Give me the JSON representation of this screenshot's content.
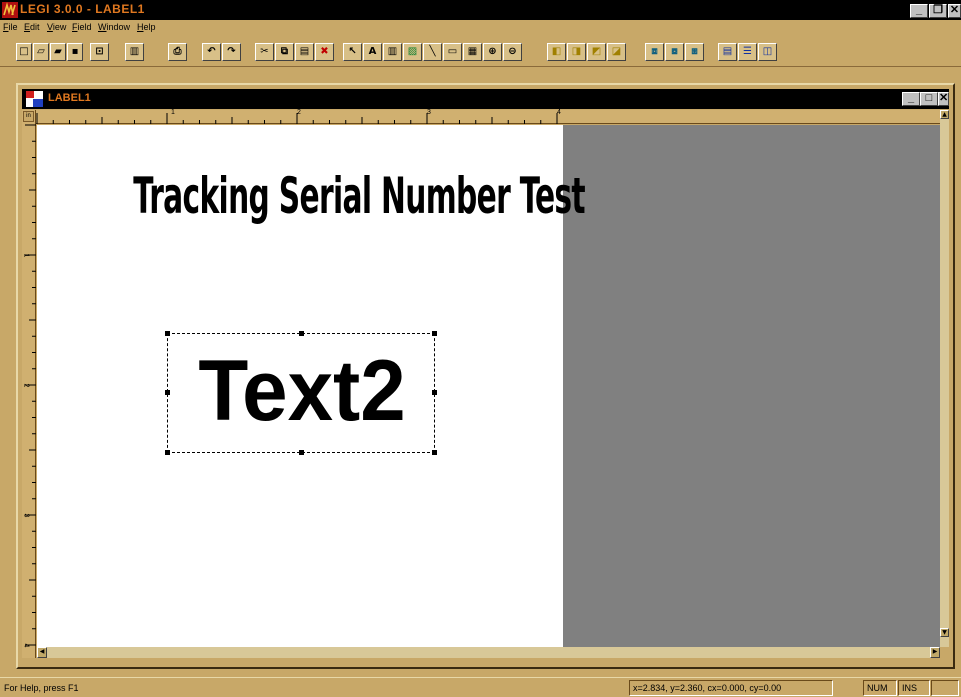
{
  "app": {
    "title": "LEGI 3.0.0 - LABEL1",
    "window_buttons": {
      "minimize": "_",
      "restore": "❐",
      "close": "✕"
    }
  },
  "menubar": {
    "items": [
      {
        "label": "File"
      },
      {
        "label": "Edit"
      },
      {
        "label": "View"
      },
      {
        "label": "Field"
      },
      {
        "label": "Window"
      },
      {
        "label": "Help"
      }
    ]
  },
  "toolbar": {
    "buttons": [
      {
        "name": "new-icon",
        "glyph": "□"
      },
      {
        "name": "open-icon",
        "glyph": "▱"
      },
      {
        "name": "open-folder-icon",
        "glyph": "▰"
      },
      {
        "name": "save-icon",
        "glyph": "▪"
      },
      {
        "name": "preview-icon",
        "glyph": "⊡"
      },
      {
        "name": "database-icon",
        "glyph": "▥"
      },
      {
        "name": "print-icon",
        "glyph": "⎙"
      },
      {
        "name": "undo-icon",
        "glyph": "↶"
      },
      {
        "name": "redo-icon",
        "glyph": "↷"
      },
      {
        "name": "cut-icon",
        "glyph": "✂"
      },
      {
        "name": "copy-icon",
        "glyph": "⧉"
      },
      {
        "name": "paste-icon",
        "glyph": "▤"
      },
      {
        "name": "delete-icon",
        "glyph": "✖"
      },
      {
        "name": "pointer-icon",
        "glyph": "↖"
      },
      {
        "name": "text-tool-icon",
        "glyph": "A"
      },
      {
        "name": "barcode-tool-icon",
        "glyph": "▥"
      },
      {
        "name": "image-tool-icon",
        "glyph": "▨"
      },
      {
        "name": "line-tool-icon",
        "glyph": "╲"
      },
      {
        "name": "rectangle-tool-icon",
        "glyph": "▭"
      },
      {
        "name": "grid-tool-icon",
        "glyph": "▦"
      },
      {
        "name": "zoom-in-icon",
        "glyph": "⊕"
      },
      {
        "name": "zoom-out-icon",
        "glyph": "⊖"
      },
      {
        "name": "align-left-icon",
        "glyph": "◧"
      },
      {
        "name": "align-center-icon",
        "glyph": "◨"
      },
      {
        "name": "align-right-icon",
        "glyph": "◩"
      },
      {
        "name": "align-top-icon",
        "glyph": "◪"
      },
      {
        "name": "bring-front-icon",
        "glyph": "⧈"
      },
      {
        "name": "send-back-icon",
        "glyph": "⧇"
      },
      {
        "name": "group-icon",
        "glyph": "⧆"
      },
      {
        "name": "order-icon",
        "glyph": "▤"
      },
      {
        "name": "space-vertical-icon",
        "glyph": "☰"
      },
      {
        "name": "space-horizontal-icon",
        "glyph": "◫"
      }
    ]
  },
  "child_window": {
    "title": "LABEL1",
    "ruler_unit": "in",
    "h_ruler_numbers": [
      "1",
      "2",
      "3",
      "4"
    ],
    "v_ruler_numbers": [
      "1",
      "2",
      "3",
      "4"
    ]
  },
  "label": {
    "heading": "Tracking Serial Number Test",
    "field_text": "Text2"
  },
  "statusbar": {
    "help_text": "For Help, press F1",
    "coordinates": "x=2.834, y=2.360, cx=0.000, cy=0.00",
    "num": "NUM",
    "ins": "INS"
  },
  "colors": {
    "frame": "#c8a868",
    "title_bar": "#000000",
    "title_text": "#e07820",
    "workspace": "#808080",
    "label_background": "#ffffff"
  }
}
